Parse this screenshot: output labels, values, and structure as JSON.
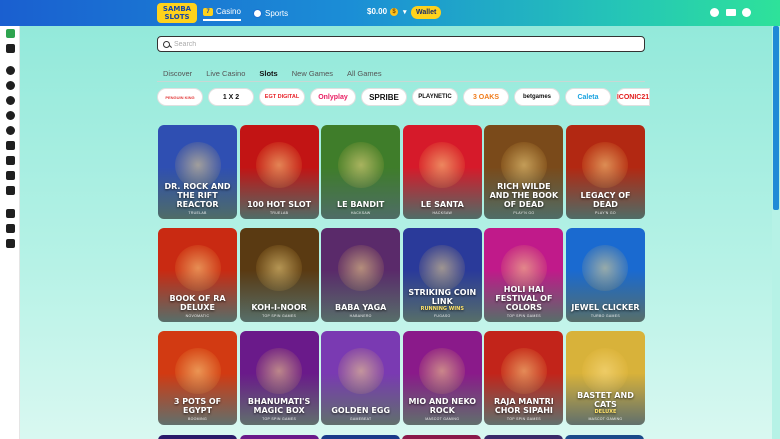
{
  "header": {
    "logo": "SAMBA SLOTS",
    "nav": [
      {
        "label": "Casino",
        "icon": "casino-icon"
      },
      {
        "label": "Sports",
        "icon": "soccer-ball-icon"
      }
    ],
    "balance": "$0.00",
    "currency_icon": "coin-icon",
    "wallet_label": "Wallet",
    "right_icons": [
      "promotions-icon",
      "mail-icon",
      "user-icon"
    ]
  },
  "sidebar_icons": [
    "casino-icon",
    "wallet-icon",
    "star-icon",
    "live-icon",
    "play-icon",
    "tennis-icon",
    "basketball-icon",
    "horseshoe-icon",
    "car-icon",
    "football-icon",
    "building-icon",
    "fire-icon",
    "megaphone-icon",
    "handshake-icon"
  ],
  "search": {
    "placeholder": "Search",
    "value": ""
  },
  "tabs": [
    {
      "label": "Discover"
    },
    {
      "label": "Live Casino"
    },
    {
      "label": "Slots",
      "active": true
    },
    {
      "label": "New Games"
    },
    {
      "label": "All Games"
    }
  ],
  "providers": [
    {
      "name": "PENGUIN KING",
      "color": "#e23b3b"
    },
    {
      "name": "1 X 2",
      "color": "#111111"
    },
    {
      "name": "EGT DIGITAL",
      "color": "#e8232a"
    },
    {
      "name": "Onlyplay",
      "color": "#e91e63"
    },
    {
      "name": "SPRIBE",
      "color": "#111111"
    },
    {
      "name": "PLAYNETIC",
      "color": "#111111"
    },
    {
      "name": "3 OAKS",
      "color": "#f07b1a"
    },
    {
      "name": "betgames",
      "color": "#111111"
    },
    {
      "name": "Caleta",
      "color": "#1aa3e0"
    },
    {
      "name": "ICONIC21",
      "color": "#e21b1b"
    }
  ],
  "games": [
    {
      "title": "DR. ROCK AND THE RIFT REACTOR",
      "provider": "TRUELAB",
      "color": "#2f4fb2"
    },
    {
      "title": "100 HOT SLOT",
      "provider": "TRUELAB",
      "color": "#c21414"
    },
    {
      "title": "LE BANDIT",
      "provider": "HACKSAW",
      "color": "#3f7d2a"
    },
    {
      "title": "LE SANTA",
      "provider": "HACKSAW",
      "color": "#d61a2a"
    },
    {
      "title": "RICH WILDE AND THE BOOK OF DEAD",
      "provider": "PLAY'N GO",
      "color": "#7a4a1a"
    },
    {
      "title": "LEGACY OF DEAD",
      "provider": "PLAY'N GO",
      "color": "#b22812"
    },
    {
      "title": "BOOK OF RA DELUXE",
      "provider": "NOVOMATIC",
      "color": "#c92a12"
    },
    {
      "title": "KOH-I-NOOR",
      "provider": "TOP SPIN GAMES",
      "color": "#5a3a12"
    },
    {
      "title": "BABA YAGA",
      "provider": "HABANERO",
      "color": "#5a2a6a"
    },
    {
      "title": "STRIKING COIN LINK",
      "subtitle": "RUNNING WINS",
      "provider": "FUGASO",
      "color": "#2a3a9a"
    },
    {
      "title": "HOLI HAI FESTIVAL OF COLORS",
      "provider": "TOP SPIN GAMES",
      "color": "#c01a8a"
    },
    {
      "title": "JEWEL CLICKER",
      "provider": "TURBO GAMES",
      "color": "#1a6ad0"
    },
    {
      "title": "3 POTS OF EGYPT",
      "provider": "BOOMING",
      "color": "#d23a12"
    },
    {
      "title": "BHANUMATI'S MAGIC BOX",
      "provider": "TOP SPIN GAMES",
      "color": "#6a1a8a"
    },
    {
      "title": "GOLDEN EGG",
      "provider": "GAMEBEAT",
      "color": "#7a3ab2"
    },
    {
      "title": "MIO AND NEKO ROCK",
      "provider": "MASCOT GAMING",
      "color": "#8a1a8a"
    },
    {
      "title": "RAJA MANTRI CHOR SIPAHI",
      "provider": "TOP SPIN GAMES",
      "color": "#c2241a"
    },
    {
      "title": "BASTET AND CATS",
      "subtitle": "DELUXE",
      "provider": "MASCOT GAMING",
      "color": "#d8b23a"
    }
  ]
}
